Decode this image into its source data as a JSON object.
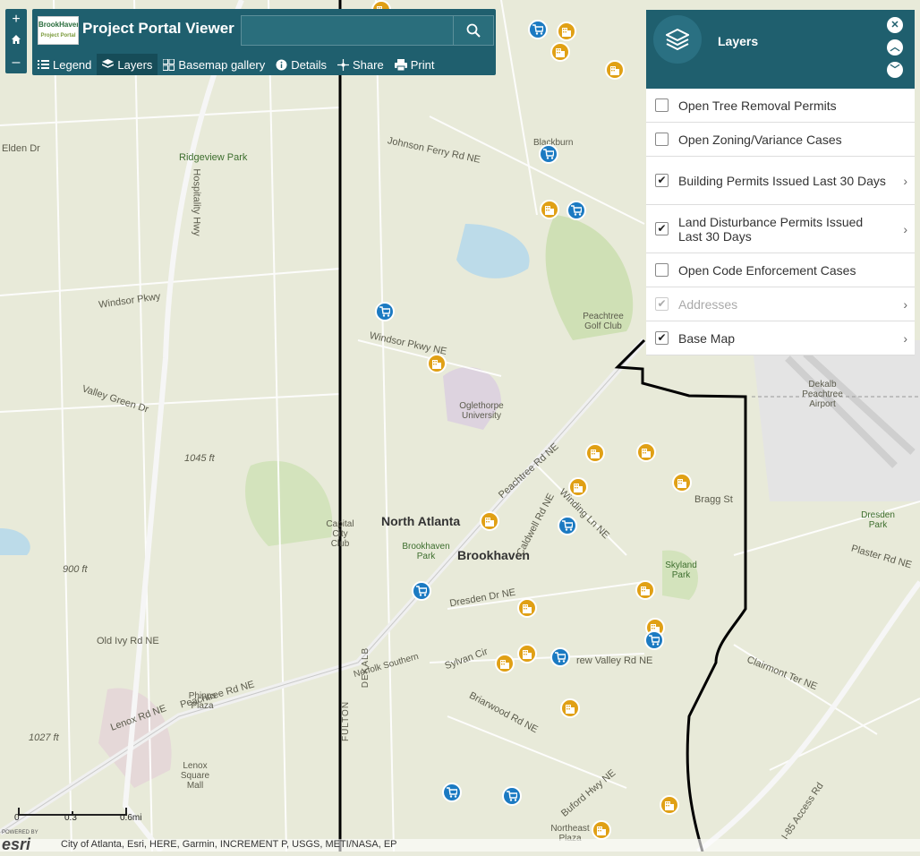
{
  "app": {
    "title": "Project Portal Viewer",
    "logo_text_line1": "BrookHaven",
    "logo_text_line2": "Project Portal",
    "search_placeholder": ""
  },
  "zoom": {
    "in": "+",
    "home": "home-icon",
    "out": "–"
  },
  "toolbar": {
    "legend": "Legend",
    "layers": "Layers",
    "basemap": "Basemap gallery",
    "details": "Details",
    "share": "Share",
    "print": "Print"
  },
  "layers_panel": {
    "title": "Layers",
    "items": [
      {
        "label": "Open Tree Removal Permits",
        "checked": false,
        "enabled": true,
        "expand": false
      },
      {
        "label": "Open Zoning/Variance Cases",
        "checked": false,
        "enabled": true,
        "expand": false
      },
      {
        "label": "Building Permits Issued Last 30 Days",
        "checked": true,
        "enabled": true,
        "expand": true
      },
      {
        "label": "Land Disturbance Permits Issued Last 30 Days",
        "checked": true,
        "enabled": true,
        "expand": true
      },
      {
        "label": "Open Code Enforcement Cases",
        "checked": false,
        "enabled": true,
        "expand": false
      },
      {
        "label": "Addresses",
        "checked": true,
        "enabled": false,
        "expand": true
      },
      {
        "label": "Base Map",
        "checked": true,
        "enabled": true,
        "expand": true
      }
    ]
  },
  "map_labels": {
    "north_atlanta": "North Atlanta",
    "brookhaven": "Brookhaven",
    "elden": "Elden Dr",
    "ridgeview": "Ridgeview Park",
    "johnson_ferry": "Johnson Ferry Rd NE",
    "blackburn": "Blackburn",
    "windsor": "Windsor Pkwy",
    "windsor_ne": "Windsor Pkwy NE",
    "oglethorpe": "Oglethorpe University",
    "peachtree_golf": "Peachtree Golf Club",
    "dekalb_airport": "Dekalb Peachtree Airport",
    "valley_green": "Valley Green Dr",
    "capital_city": "Capital City Club",
    "brookhaven_park": "Brookhaven Park",
    "skyland_park": "Skyland Park",
    "dresden_park": "Dresden Park",
    "bragg": "Bragg St",
    "dresden_dr": "Dresden Dr NE",
    "phipps": "Phipps Plaza",
    "lenox_sq": "Lenox Square Mall",
    "northeast_plaza": "Northeast Plaza",
    "lenox_rd": "Lenox Rd NE",
    "peachtree_rd": "Peachtree Rd NE",
    "peachtree_rd2": "Peachtree Rd NE",
    "plaster": "Plaster Rd NE",
    "clairmont_ter": "Clairmont Ter NE",
    "elev_1045": "1045 ft",
    "elev_1027": "1027 ft",
    "elev_900": "900 ft",
    "old_ivy": "Old Ivy Rd NE",
    "hospitality": "Hospitality Hwy",
    "fulton": "FULTON",
    "dekalb": "DEKALB",
    "buford": "Buford Hwy NE",
    "i85": "I-85 Access Rd",
    "sylvan": "Sylvan Cir",
    "briarwood": "Briarwood Rd NE",
    "drew_valley": "rew Valley Rd NE",
    "norfolk": "Norfolk Southern",
    "winding": "Winding Ln NE",
    "caldwell": "Caldwell Rd NE"
  },
  "scale": {
    "zero": "0",
    "mid": "0.3",
    "max": "0.6mi"
  },
  "attribution": "City of Atlanta, Esri, HERE, Garmin, INCREMENT P, USGS, METI/NASA, EP",
  "esri": "esri",
  "powered_by": "POWERED BY",
  "colors": {
    "panel": "#1f5f6e",
    "pin_orange": "#e0a015",
    "pin_blue": "#1b7ac2",
    "boundary": "#000000"
  }
}
